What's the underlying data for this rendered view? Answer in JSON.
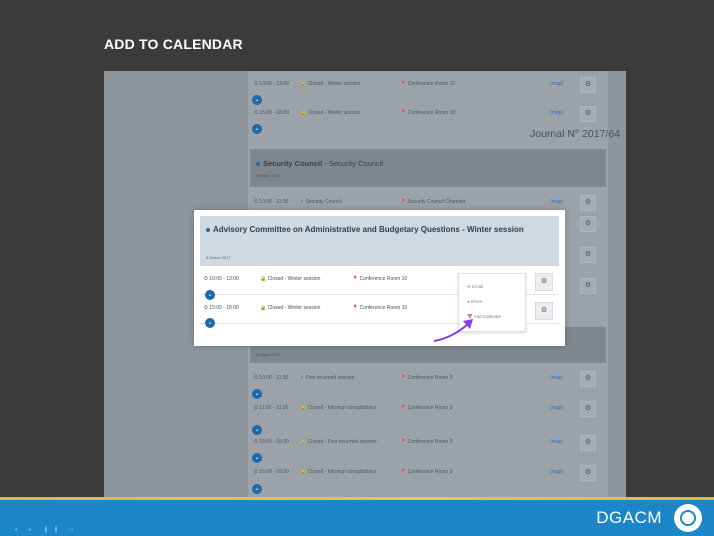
{
  "slide": {
    "title": "ADD TO CALENDAR"
  },
  "journal": "Journal N° 2017/64",
  "background": {
    "top_rows": [
      {
        "time": "⏱ 10:00 - 13:00",
        "closed": "🔒 Closed - Winter session",
        "room": "📍 Conference Room 10",
        "map": "(map)"
      },
      {
        "time": "⏱ 15:00 - 18:00",
        "closed": "🔒 Closed - Winter session",
        "room": "📍 Conference Room 10",
        "map": "(map)"
      }
    ],
    "section": {
      "name": "Security Council",
      "suffix": " - Security Council",
      "date": "9 March 2017"
    },
    "sc_row": {
      "time": "⏱ 10:00 - 11:00",
      "closed": "✓ Security Council",
      "room": "📍 Security Council Chamber",
      "map": "(map)"
    },
    "section2_date": "9 March 2017",
    "bottom_rows": [
      {
        "time": "⏱ 10:00 - 11:30",
        "closed": "✓ First resumed session",
        "room": "📍 Conference Room 3",
        "map": "(map)"
      },
      {
        "time": "⏱ 11:00 - 13:00",
        "closed": "🔒 Closed - Informal consultations",
        "room": "📍 Conference Room 3",
        "map": "(map)"
      },
      {
        "time": "⏱ 15:00 - 16:00",
        "closed": "🔒 Closed - First resumed session",
        "room": "📍 Conference Room 3",
        "map": "(map)"
      },
      {
        "time": "⏱ 15:00 - 18:00",
        "closed": "🔒 Closed - Informal consultations",
        "room": "📍 Conference Room 3",
        "map": "(map)"
      }
    ]
  },
  "popup": {
    "title": "Advisory Committee on Administrative and Budgetary Questions - Winter session",
    "date": "9 March 2017",
    "rows": [
      {
        "time": "⏱ 10:00 - 13:00",
        "closed": "🔒 Closed - Winter session",
        "room": "📍 Conference Room 10"
      },
      {
        "time": "⏱ 15:00 - 18:00",
        "closed": "🔒 Closed - Winter session",
        "room": "📍 Conference Room 10"
      }
    ],
    "menu": {
      "email": "✉ Email",
      "share": "◂ Share",
      "add_calendar": "📅 Add Calendar"
    }
  },
  "icons": {
    "gear": "⚙",
    "chevron": "⌄"
  },
  "footer": {
    "brand": "DGACM",
    "player": "◂ ▸ ❚❚ ◃"
  },
  "colors": {
    "accent": "#1b86c8",
    "arrow": "#8a3ee0",
    "footer_line": "#f2c063"
  }
}
